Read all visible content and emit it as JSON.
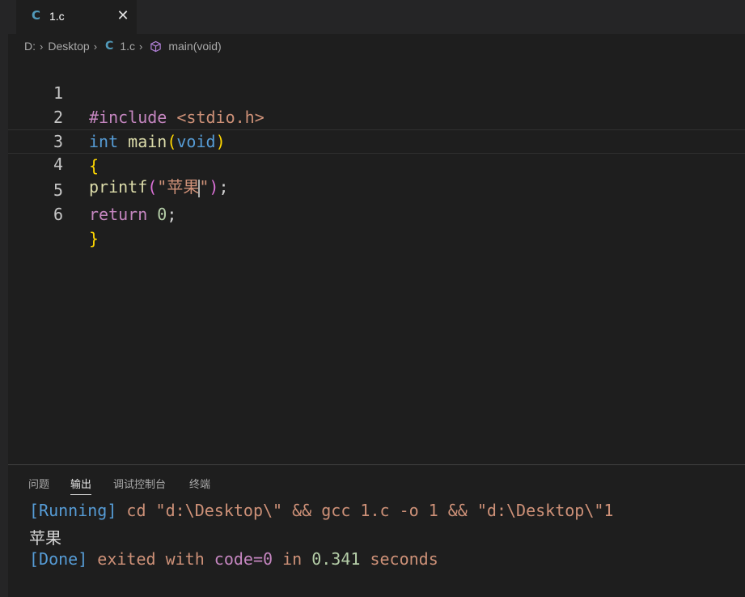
{
  "tab": {
    "icon": "C",
    "label": "1.c",
    "close": "✕"
  },
  "breadcrumb": {
    "drive": "D:",
    "folder": "Desktop",
    "file_icon": "C",
    "file": "1.c",
    "symbol": "main(void)"
  },
  "editor": {
    "lines": [
      {
        "number": "1",
        "parts": [
          "#include",
          " ",
          "<stdio.h>"
        ]
      },
      {
        "number": "2",
        "parts": [
          "int",
          " ",
          "main",
          "(",
          "void",
          ")"
        ]
      },
      {
        "number": "3",
        "parts": [
          "{"
        ]
      },
      {
        "number": "4",
        "parts": [
          "printf",
          "(",
          "\"苹果",
          "\"",
          ")",
          ";"
        ]
      },
      {
        "number": "5",
        "parts": [
          "return",
          " ",
          "0",
          ";"
        ]
      },
      {
        "number": "6",
        "parts": [
          "}"
        ]
      }
    ]
  },
  "panel": {
    "tabs": [
      "问题",
      "输出",
      "调试控制台",
      "终端"
    ],
    "active_tab": "输出",
    "output": {
      "line1": {
        "tag": "[Running]",
        "command": " cd \"d:\\Desktop\\\" && gcc 1.c -o 1 && \"d:\\Desktop\\\"1"
      },
      "line2": "苹果",
      "line3": {
        "tag": "[Done]",
        "text1": " exited with ",
        "code": "code=0",
        "text2": " in ",
        "time": "0.341",
        "text3": " seconds"
      }
    }
  },
  "colors": {
    "editor_bg": "#1e1e1e",
    "tabbar_bg": "#252526",
    "c_icon": "#519aba",
    "cube_icon": "#b180d7"
  }
}
